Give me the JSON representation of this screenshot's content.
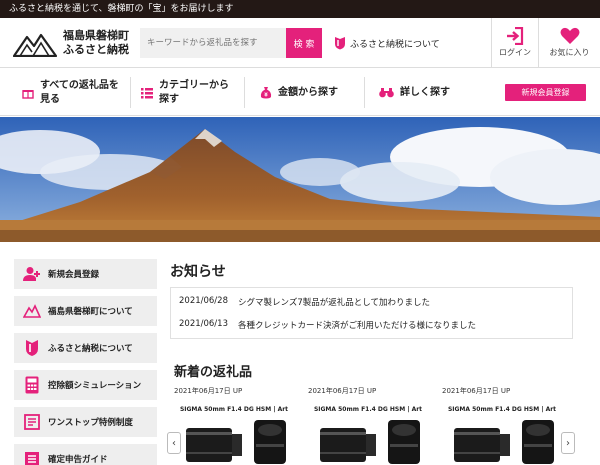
{
  "topbar": {
    "text": "ふるさと納税を通じて、磐梯町の「宝」をお届けします"
  },
  "header": {
    "logo_line1": "福島県磐梯町",
    "logo_line2": "ふるさと納税",
    "search_placeholder": "キーワードから返礼品を探す",
    "search_button": "検 索",
    "about_link": "ふるさと納税について",
    "login_label": "ログイン",
    "fav_label": "お気に入り"
  },
  "nav": {
    "items": [
      {
        "line1": "すべての返礼品を",
        "line2": "見る"
      },
      {
        "line1": "カテゴリーから",
        "line2": "探す"
      },
      {
        "line1": "金額から探す",
        "line2": ""
      },
      {
        "line1": "詳しく探す",
        "line2": ""
      }
    ],
    "register": "新規会員登録"
  },
  "sidebar": {
    "items": [
      {
        "label": "新規会員登録",
        "icon": "user-plus-icon"
      },
      {
        "label": "福島県磐梯町について",
        "icon": "mountain-icon"
      },
      {
        "label": "ふるさと納税について",
        "icon": "shield-icon"
      },
      {
        "label": "控除額シミュレーション",
        "icon": "calculator-icon"
      },
      {
        "label": "ワンストップ特例制度",
        "icon": "document-icon"
      },
      {
        "label": "確定申告ガイド",
        "icon": "guide-icon"
      }
    ]
  },
  "news": {
    "title": "お知らせ",
    "items": [
      {
        "date": "2021/06/28",
        "text": "シグマ製レンズ7製品が返礼品として加わりました"
      },
      {
        "date": "2021/06/13",
        "text": "各種クレジットカード決済がご利用いただける様になりました"
      }
    ]
  },
  "new_items": {
    "title": "新着の返礼品",
    "products": [
      {
        "date": "2021年06月17日 UP",
        "name": "SIGMA 50mm F1.4 DG HSM | Art"
      },
      {
        "date": "2021年06月17日 UP",
        "name": "SIGMA 50mm F1.4 DG HSM | Art"
      },
      {
        "date": "2021年06月17日 UP",
        "name": "SIGMA 50mm F1.4 DG HSM | Art"
      }
    ],
    "prev": "‹",
    "next": "›"
  },
  "colors": {
    "accent": "#e4217b",
    "topbar": "#231815",
    "sidebar_bg": "#eeeeee"
  }
}
